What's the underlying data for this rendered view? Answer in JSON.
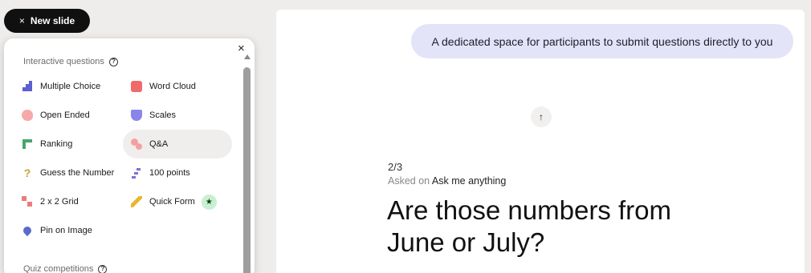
{
  "new_slide": {
    "label": "New slide",
    "icon": "×"
  },
  "panel": {
    "close_icon": "×",
    "section_interactive": "Interactive questions",
    "section_quiz": "Quiz competitions",
    "help_icon": "?",
    "items": [
      {
        "label": "Multiple Choice",
        "icon": "bar-chart-icon"
      },
      {
        "label": "Word Cloud",
        "icon": "word-cloud-icon"
      },
      {
        "label": "Open Ended",
        "icon": "open-ended-icon"
      },
      {
        "label": "Scales",
        "icon": "scales-icon"
      },
      {
        "label": "Ranking",
        "icon": "ranking-icon"
      },
      {
        "label": "Q&A",
        "icon": "qa-icon"
      },
      {
        "label": "Guess the Number",
        "icon": "question-mark-icon"
      },
      {
        "label": "100 points",
        "icon": "points-icon"
      },
      {
        "label": "2 x 2 Grid",
        "icon": "grid-icon"
      },
      {
        "label": "Quick Form",
        "icon": "pencil-icon",
        "badge": "★"
      },
      {
        "label": "Pin on Image",
        "icon": "pin-icon"
      }
    ]
  },
  "slide": {
    "bubble_text": "A dedicated space for participants to submit questions directly to you",
    "arrow_icon": "↑",
    "counter": "2/3",
    "asked_prefix": "Asked on",
    "asked_event": "Ask me anything",
    "question": "Are those numbers from June or July?"
  },
  "colors": {
    "accent_bubble": "#e3e4f8",
    "badge": "#c9efd1",
    "button_dark": "#101010"
  }
}
